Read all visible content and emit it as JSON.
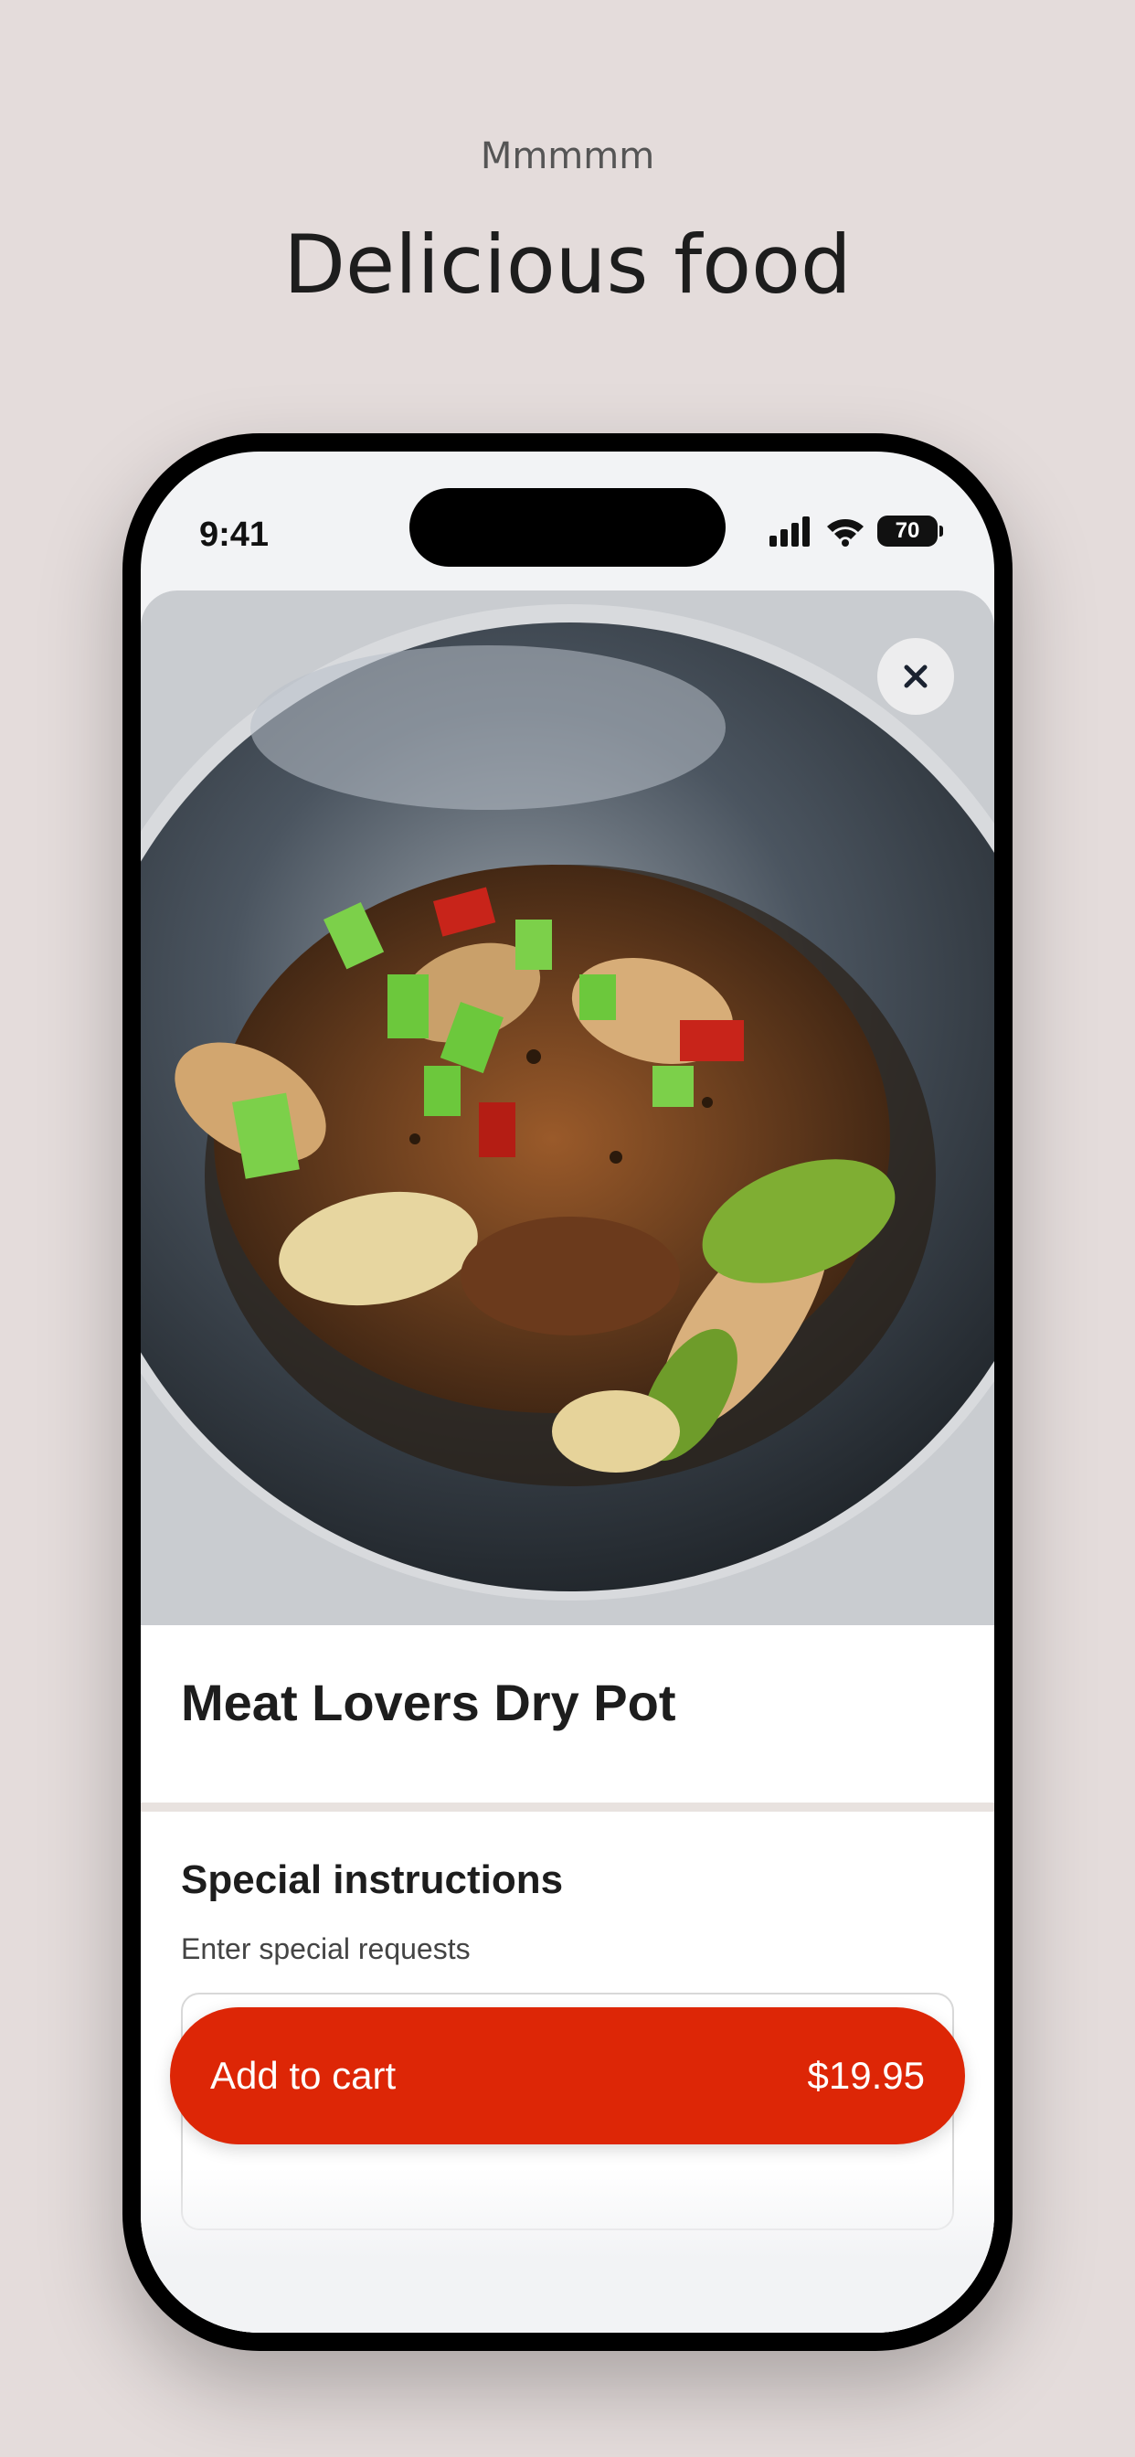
{
  "promo": {
    "eyebrow": "Mmmmm",
    "title": "Delicious food"
  },
  "status_bar": {
    "time": "9:41",
    "battery": "70",
    "icons": [
      "cellular-signal-icon",
      "wifi-icon",
      "battery-icon"
    ]
  },
  "item": {
    "name": "Meat Lovers Dry Pot",
    "image_icon": "food-photo"
  },
  "special_instructions": {
    "heading": "Special instructions",
    "label": "Enter special requests",
    "placeholder": "Enter special requests",
    "value": ""
  },
  "cart_button": {
    "label": "Add to cart",
    "price": "$19.95"
  },
  "colors": {
    "background": "#e4dcdb",
    "accent": "#dd2606",
    "phone_frame": "#000000",
    "text": "#1d1d1d"
  }
}
